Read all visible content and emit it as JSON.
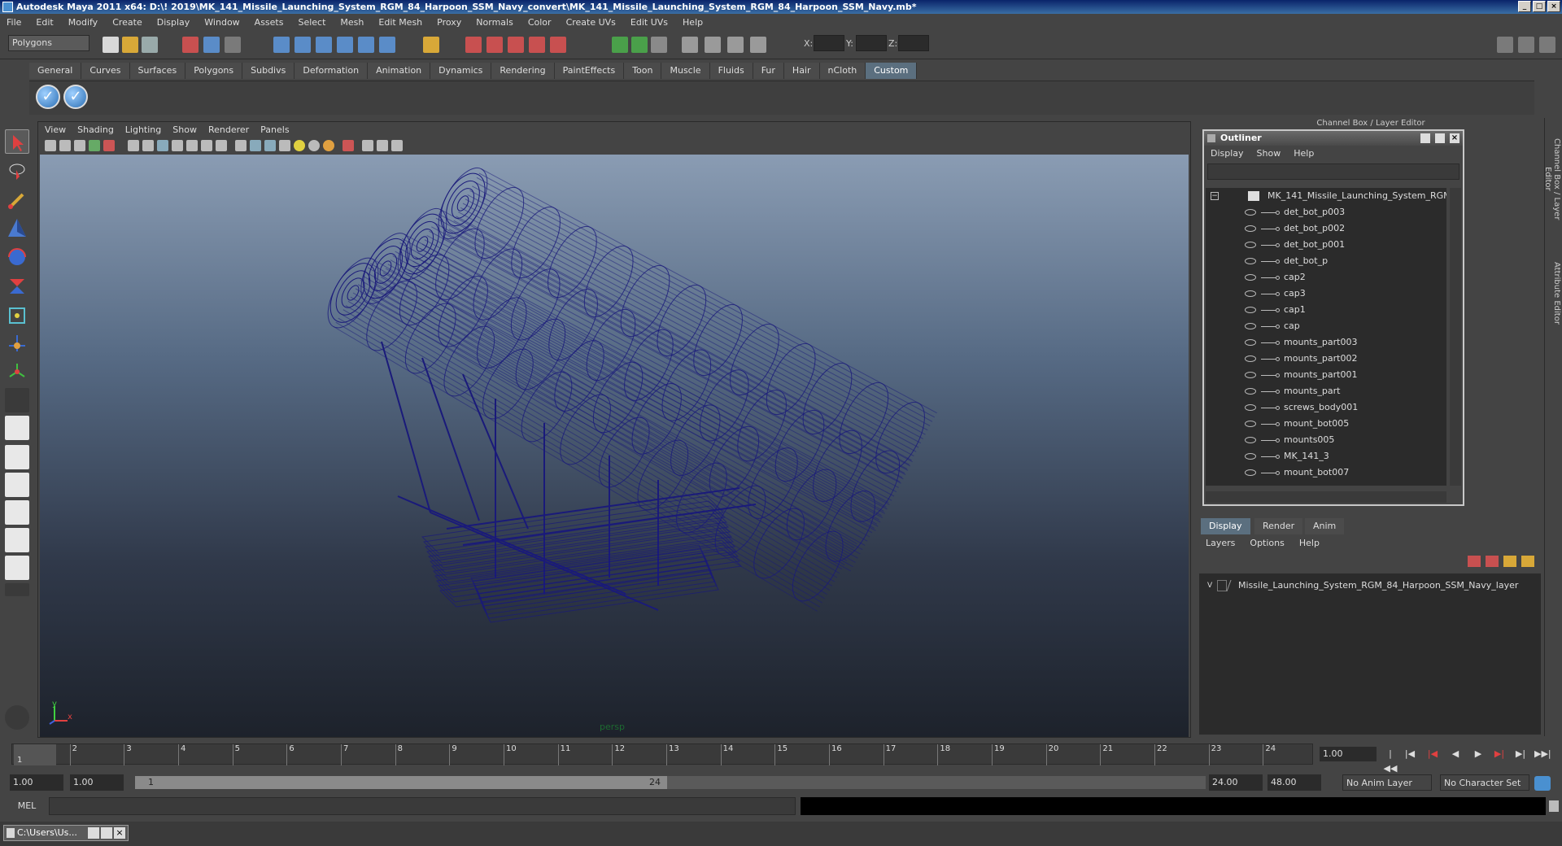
{
  "window": {
    "title": "Autodesk Maya 2011 x64: D:\\! 2019\\MK_141_Missile_Launching_System_RGM_84_Harpoon_SSM_Navy_convert\\MK_141_Missile_Launching_System_RGM_84_Harpoon_SSM_Navy.mb*"
  },
  "menubar": [
    "File",
    "Edit",
    "Modify",
    "Create",
    "Display",
    "Window",
    "Assets",
    "Select",
    "Mesh",
    "Edit Mesh",
    "Proxy",
    "Normals",
    "Color",
    "Create UVs",
    "Edit UVs",
    "Help"
  ],
  "statusline": {
    "mode": "Polygons",
    "x_label": "X:",
    "y_label": "Y:",
    "z_label": "Z:"
  },
  "shelf": {
    "tabs": [
      "General",
      "Curves",
      "Surfaces",
      "Polygons",
      "Subdivs",
      "Deformation",
      "Animation",
      "Dynamics",
      "Rendering",
      "PaintEffects",
      "Toon",
      "Muscle",
      "Fluids",
      "Fur",
      "Hair",
      "nCloth",
      "Custom"
    ],
    "active_tab": "Custom"
  },
  "viewport": {
    "menu": [
      "View",
      "Shading",
      "Lighting",
      "Show",
      "Renderer",
      "Panels"
    ],
    "camera_label": "persp",
    "axis_y": "y",
    "axis_x": "x",
    "wire_color": "#1a1a7a"
  },
  "channel_box_label": "Channel Box / Layer Editor",
  "side_tabs": {
    "channel": "Channel Box / Layer Editor",
    "attribute": "Attribute Editor"
  },
  "outliner": {
    "title": "Outliner",
    "menu": [
      "Display",
      "Show",
      "Help"
    ],
    "root": "MK_141_Missile_Launching_System_RGM_84_",
    "items": [
      "det_bot_p003",
      "det_bot_p002",
      "det_bot_p001",
      "det_bot_p",
      "cap2",
      "cap3",
      "cap1",
      "cap",
      "mounts_part003",
      "mounts_part002",
      "mounts_part001",
      "mounts_part",
      "screws_body001",
      "mount_bot005",
      "mounts005",
      "MK_141_3",
      "mount_bot007"
    ]
  },
  "layer_editor": {
    "tabs": [
      "Display",
      "Render",
      "Anim"
    ],
    "active_tab": "Display",
    "menu": [
      "Layers",
      "Options",
      "Help"
    ],
    "layer_visible": "V",
    "layer_name": "Missile_Launching_System_RGM_84_Harpoon_SSM_Navy_layer"
  },
  "timeline": {
    "ticks": [
      "1",
      "2",
      "3",
      "4",
      "5",
      "6",
      "7",
      "8",
      "9",
      "10",
      "11",
      "12",
      "13",
      "14",
      "15",
      "16",
      "17",
      "18",
      "19",
      "20",
      "21",
      "22",
      "23",
      "24"
    ],
    "current_frame": "1.00",
    "playhead_label": "1"
  },
  "range": {
    "start": "1.00",
    "playback_start": "1.00",
    "handle_start": "1",
    "handle_end": "24",
    "playback_end": "24.00",
    "end": "48.00",
    "anim_layer": "No Anim Layer",
    "character_set": "No Character Set"
  },
  "command": {
    "label": "MEL"
  },
  "taskbar": {
    "item": "C:\\Users\\Us..."
  }
}
